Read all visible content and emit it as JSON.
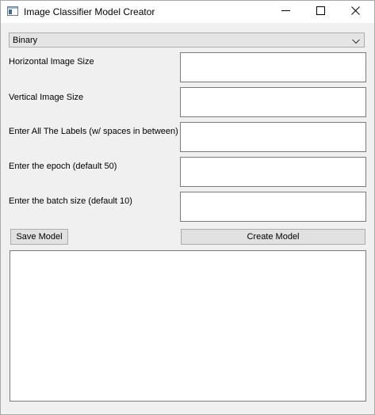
{
  "window": {
    "title": "Image Classifier Model Creator"
  },
  "model_type": {
    "selected": "Binary"
  },
  "fields": [
    {
      "label": "Horizontal Image Size",
      "value": ""
    },
    {
      "label": "Vertical Image Size",
      "value": ""
    },
    {
      "label": "Enter All The Labels (w/ spaces in between)",
      "value": ""
    },
    {
      "label": "Enter the epoch (default 50)",
      "value": ""
    },
    {
      "label": "Enter the batch size (default 10)",
      "value": ""
    }
  ],
  "buttons": {
    "save_label": "Save Model",
    "create_label": "Create Model"
  },
  "output": {
    "text": ""
  },
  "icons": {
    "app": "app-window-icon",
    "minimize": "minimize-icon",
    "maximize": "maximize-icon",
    "close": "close-icon",
    "dropdown": "chevron-down-icon"
  }
}
